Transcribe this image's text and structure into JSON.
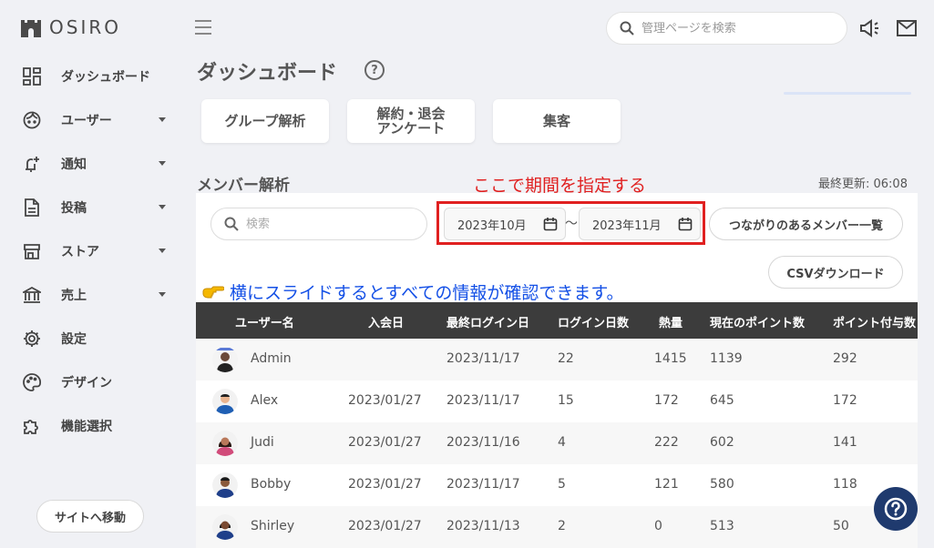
{
  "brand": {
    "name": "OSIRO"
  },
  "sidebar": {
    "items": [
      {
        "label": "ダッシュボード",
        "icon": "dashboard-icon",
        "has_caret": false
      },
      {
        "label": "ユーザー",
        "icon": "user-face-icon",
        "has_caret": true
      },
      {
        "label": "通知",
        "icon": "bell-plus-icon",
        "has_caret": true
      },
      {
        "label": "投稿",
        "icon": "document-icon",
        "has_caret": true
      },
      {
        "label": "ストア",
        "icon": "store-icon",
        "has_caret": true
      },
      {
        "label": "売上",
        "icon": "bank-icon",
        "has_caret": true
      },
      {
        "label": "設定",
        "icon": "gear-icon",
        "has_caret": false
      },
      {
        "label": "デザイン",
        "icon": "palette-icon",
        "has_caret": false
      },
      {
        "label": "機能選択",
        "icon": "puzzle-icon",
        "has_caret": false
      }
    ],
    "site_button": "サイトへ移動"
  },
  "header": {
    "search_placeholder": "管理ページを検索"
  },
  "page": {
    "title": "ダッシュボード",
    "help_glyph": "?"
  },
  "tabs": [
    {
      "label": "グループ解析"
    },
    {
      "label": "解約・退会\nアンケート"
    },
    {
      "label": "集客"
    }
  ],
  "members": {
    "title": "メンバー解析",
    "annotation_period": "ここで期間を指定する",
    "last_updated": "最終更新: 06:08",
    "search_placeholder": "検索",
    "date_from": "2023年10月",
    "date_sep": "〜",
    "date_to": "2023年11月",
    "connected_button": "つながりのあるメンバー一覧",
    "csv_button": "CSVダウンロード",
    "annotation_slide": "横にスライドするとすべての情報が確認できます。",
    "columns": [
      "ユーザー名",
      "入会日",
      "最終ログイン日",
      "ログイン日数",
      "熱量",
      "現在のポイント数",
      "ポイント付与数"
    ],
    "rows": [
      {
        "name": "Admin",
        "joined": "",
        "last_login": "2023/11/17",
        "login_days": "22",
        "heat": "1415",
        "points": "1139",
        "granted": "292"
      },
      {
        "name": "Alex",
        "joined": "2023/01/27",
        "last_login": "2023/11/17",
        "login_days": "15",
        "heat": "172",
        "points": "645",
        "granted": "172"
      },
      {
        "name": "Judi",
        "joined": "2023/01/27",
        "last_login": "2023/11/16",
        "login_days": "4",
        "heat": "222",
        "points": "602",
        "granted": "141"
      },
      {
        "name": "Bobby",
        "joined": "2023/01/27",
        "last_login": "2023/11/17",
        "login_days": "5",
        "heat": "121",
        "points": "580",
        "granted": "118"
      },
      {
        "name": "Shirley",
        "joined": "2023/01/27",
        "last_login": "2023/11/13",
        "login_days": "2",
        "heat": "0",
        "points": "513",
        "granted": "50"
      }
    ]
  },
  "colors": {
    "annotation_red": "#e02020",
    "annotation_blue": "#1450e6",
    "table_header": "#3c3c3c",
    "help_fab": "#1f3a6e"
  }
}
